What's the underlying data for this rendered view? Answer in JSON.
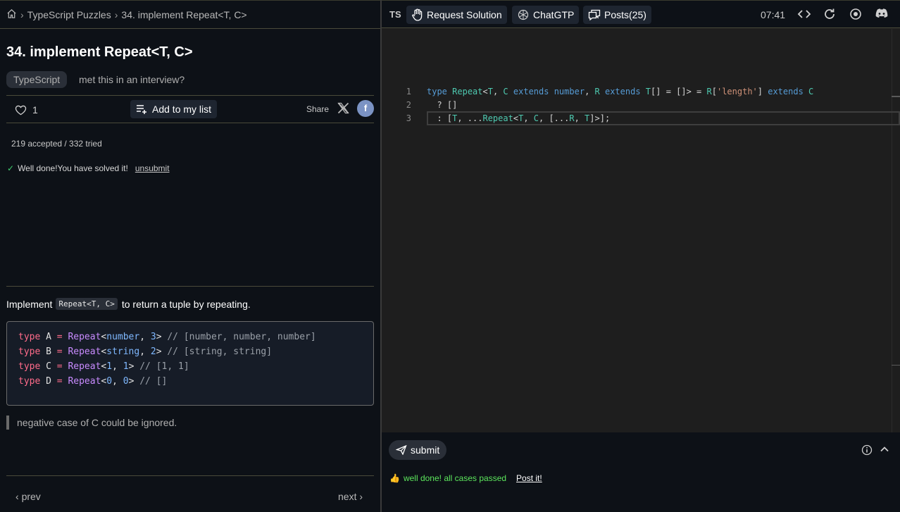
{
  "breadcrumb": {
    "home_icon": "home-icon",
    "section": "TypeScript Puzzles",
    "current": "34. implement Repeat<T, C>"
  },
  "problem": {
    "title": "34. implement Repeat<T, C>",
    "tag": "TypeScript",
    "interview_prompt": "met this in an interview?",
    "likes": "1",
    "add_to_list": "Add to my list",
    "share_label": "Share",
    "stats": "219 accepted / 332 tried",
    "solved_message": "Well done!You have solved it!",
    "unsubmit": "unsubmit",
    "description_before": "Implement",
    "description_code": "Repeat<T, C>",
    "description_after": "to return a tuple by repeating.",
    "example_lines": [
      "type A = Repeat<number, 3> // [number, number, number]",
      "type B = Repeat<string, 2> // [string, string]",
      "type C = Repeat<1, 1> // [1, 1]",
      "type D = Repeat<0, 0> // []"
    ],
    "note": "negative case of C could be ignored.",
    "prev": "prev",
    "next": "next"
  },
  "toolbar": {
    "lang": "TS",
    "request_solution": "Request Solution",
    "chatgtp": "ChatGTP",
    "posts": "Posts(25)",
    "time": "07:41"
  },
  "editor": {
    "line_numbers": [
      "1",
      "2",
      "3"
    ],
    "lines": [
      "type Repeat<T, C extends number, R extends T[] = []> = R['length'] extends C",
      "  ? []",
      "  : [T, ...Repeat<T, C, [...R, T]>];"
    ]
  },
  "bottom": {
    "submit": "submit",
    "result": "well done! all cases passed",
    "post_it": "Post it!"
  },
  "colors": {
    "background": "#0d1117",
    "editor_bg": "#1e1e1e",
    "success": "#5ce65c",
    "keyword": "#569cd6",
    "type": "#4ec9b0",
    "string": "#ce9178"
  }
}
